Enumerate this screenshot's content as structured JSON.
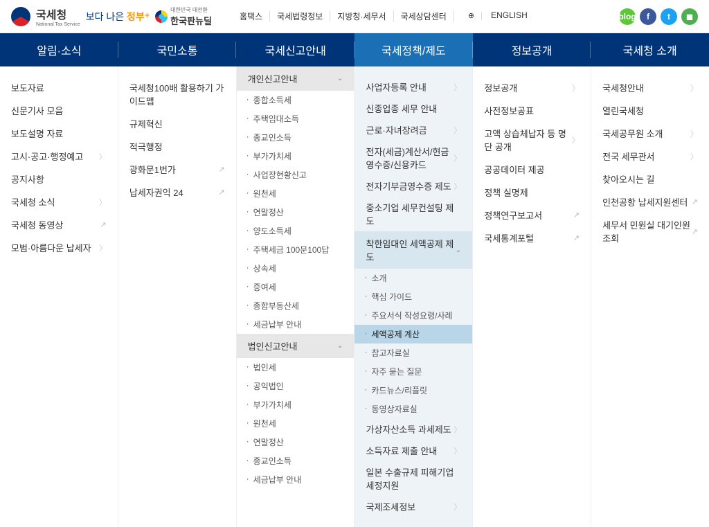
{
  "header": {
    "logo_main": "국세청",
    "logo_sub": "National Tax Service",
    "logo2_pre": "보다 나은",
    "logo2_post": "정부",
    "logo3_top": "대한민국 대전환",
    "logo3_bottom": "한국판뉴딜",
    "top_links": [
      "홈택스",
      "국세법령정보",
      "지방청·세무서",
      "국세상담센터",
      "ENGLISH"
    ]
  },
  "nav": [
    "알림·소식",
    "국민소통",
    "국세신고안내",
    "국세정책/제도",
    "정보공개",
    "국세청 소개"
  ],
  "col1": [
    {
      "label": "보도자료"
    },
    {
      "label": "신문기사 모음"
    },
    {
      "label": "보도설명 자료"
    },
    {
      "label": "고시·공고·행정예고",
      "chev": true
    },
    {
      "label": "공지사항"
    },
    {
      "label": "국세청 소식",
      "chev": true
    },
    {
      "label": "국세청 동영상",
      "ext": true
    },
    {
      "label": "모범·아름다운 납세자",
      "chev": true
    }
  ],
  "col2": [
    {
      "label": "국세청100배 활용하기 가이드맵"
    },
    {
      "label": "규제혁신"
    },
    {
      "label": "적극행정"
    },
    {
      "label": "광화문1번가",
      "ext": true
    },
    {
      "label": "납세자권익 24",
      "ext": true
    }
  ],
  "col3": {
    "head1": "개인신고안내",
    "subs1": [
      "종합소득세",
      "주택임대소득",
      "종교인소득",
      "부가가치세",
      "사업장현황신고",
      "원천세",
      "연말정산",
      "양도소득세",
      "주택세금 100문100답",
      "상속세",
      "증여세",
      "종합부동산세",
      "세금납부 안내"
    ],
    "head2": "법인신고안내",
    "subs2": [
      "법인세",
      "공익법인",
      "부가가치세",
      "원천세",
      "연말정산",
      "종교인소득",
      "세금납부 안내"
    ]
  },
  "col4": {
    "items_top": [
      {
        "label": "사업자등록 안내",
        "chev": true
      },
      {
        "label": "신종업종 세무 안내"
      },
      {
        "label": "근로·자녀장려금",
        "chev": true
      },
      {
        "label": "전자(세금)계산서/현금영수증/신용카드",
        "chev": true
      },
      {
        "label": "전자기부금영수증 제도",
        "chev": true
      },
      {
        "label": "중소기업 세무컨설팅 제도"
      }
    ],
    "head": "착한임대인 세액공제 제도",
    "subs": [
      "소개",
      "핵심 가이드",
      "주요서식 작성요령/사례",
      "세액공제 계산",
      "참고자료실",
      "자주 묻는 질문",
      "카드뉴스/리플릿",
      "동영상자료실"
    ],
    "sel_index": 3,
    "items_bottom": [
      {
        "label": "가상자산소득 과세제도",
        "chev": true
      },
      {
        "label": "소득자료 제출 안내",
        "chev": true
      },
      {
        "label": "일본 수출규제 피해기업 세정지원"
      },
      {
        "label": "국제조세정보",
        "chev": true
      }
    ]
  },
  "col5": [
    {
      "label": "정보공개",
      "chev": true
    },
    {
      "label": "사전정보공표"
    },
    {
      "label": "고액 상습체납자 등 명단 공개",
      "chev": true
    },
    {
      "label": "공공데이터 제공"
    },
    {
      "label": "정책 실명제"
    },
    {
      "label": "정책연구보고서",
      "ext": true
    },
    {
      "label": "국세통계포털",
      "ext": true
    }
  ],
  "col6": [
    {
      "label": "국세청안내",
      "chev": true
    },
    {
      "label": "열린국세청"
    },
    {
      "label": "국세공무원 소개",
      "chev": true
    },
    {
      "label": "전국 세무관서",
      "chev": true
    },
    {
      "label": "찾아오시는 길"
    },
    {
      "label": "인천공항 납세지원센터",
      "ext": true
    },
    {
      "label": "세무서 민원실 대기인원조회",
      "ext": true
    }
  ]
}
